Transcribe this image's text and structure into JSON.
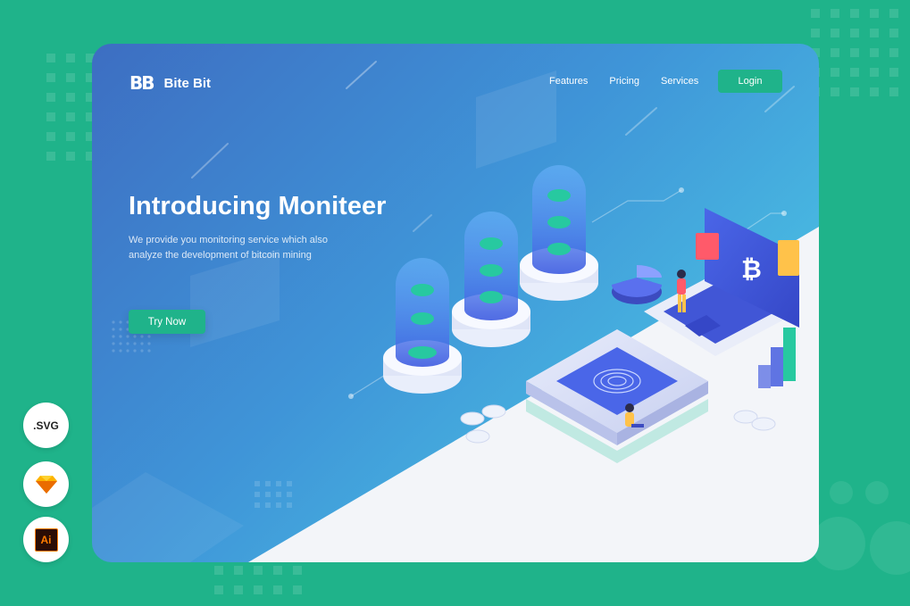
{
  "brand": {
    "logo_mark": "BB",
    "name": "Bite Bit"
  },
  "nav": {
    "links": [
      "Features",
      "Pricing",
      "Services"
    ],
    "login_label": "Login"
  },
  "hero": {
    "title": "Introducing Moniteer",
    "subtitle": "We provide you monitoring service which also analyze the development of bitcoin mining",
    "cta_label": "Try Now"
  },
  "badges": {
    "svg_label": ".SVG",
    "sketch_icon": "sketch-diamond-icon",
    "ai_label": "Ai"
  },
  "colors": {
    "accent": "#1fb38a",
    "gradient_start": "#3d6ec2",
    "gradient_end": "#4fd4e8",
    "floor": "#f3f5f9"
  }
}
